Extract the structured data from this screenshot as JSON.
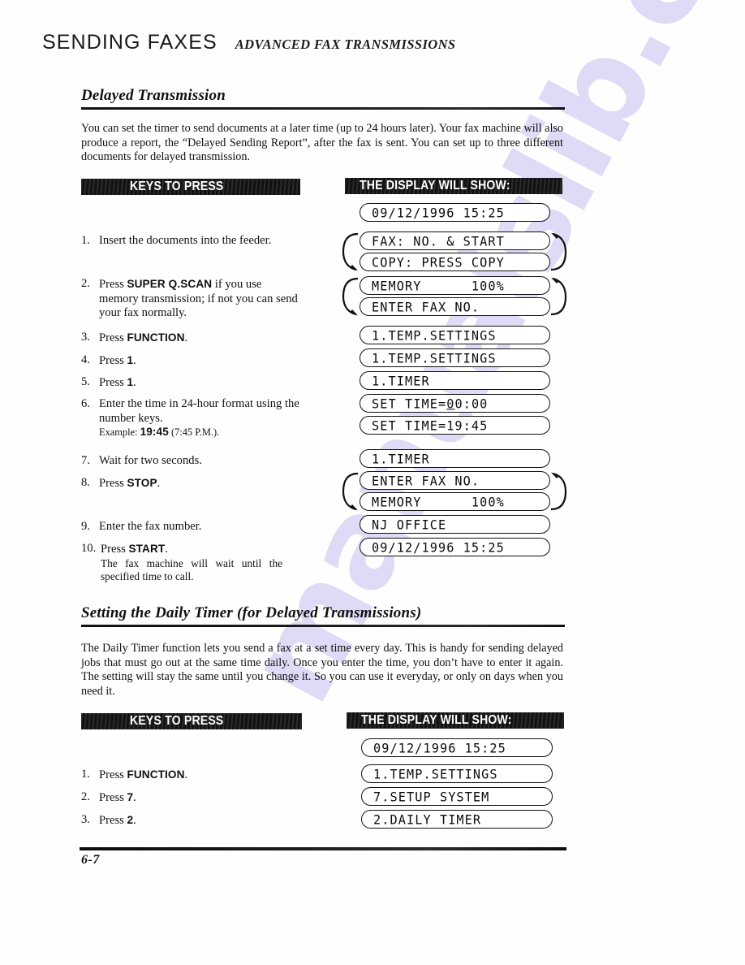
{
  "page": {
    "running_head_main": "SENDING FAXES",
    "running_head_sub": "ADVANCED FAX TRANSMISSIONS",
    "page_number": "6-7",
    "watermark": "manualslib.com"
  },
  "section1": {
    "title": "Delayed Transmission",
    "intro": "You can set the timer to send documents at a later time (up to 24 hours later). Your fax machine will also produce a report, the “Delayed Sending Report”, after the fax is sent. You can set up to three different documents for delayed transmission.",
    "keys_banner": "KEYS TO PRESS",
    "display_banner": "THE DISPLAY WILL SHOW:",
    "steps": [
      {
        "num": "1.",
        "text": "Insert the documents into the feeder."
      },
      {
        "num": "2.",
        "pre": "Press ",
        "key": "SUPER Q.SCAN",
        "post": " if you use memory transmission; if not you can send your fax normally."
      },
      {
        "num": "3.",
        "pre": "Press ",
        "key": "FUNCTION",
        "post": "."
      },
      {
        "num": "4.",
        "pre": "Press ",
        "key": "1",
        "post": "."
      },
      {
        "num": "5.",
        "pre": "Press ",
        "key": "1",
        "post": "."
      },
      {
        "num": "6.",
        "text": "Enter the time in 24-hour format using the number keys.",
        "sub_pre": "Example: ",
        "sub_key": "19:45",
        "sub_post": " (7:45 P.M.)."
      },
      {
        "num": "7.",
        "text": "Wait for two seconds."
      },
      {
        "num": "8.",
        "pre": "Press ",
        "key": "STOP",
        "post": "."
      },
      {
        "num": "9.",
        "text": "Enter the fax number."
      },
      {
        "num": "10.",
        "pre": "Press ",
        "key": "START",
        "post": ".",
        "note": "The fax machine will wait until the specified time to call."
      }
    ],
    "displays": [
      {
        "text": "09/12/1996 15:25"
      },
      {
        "text": "FAX: NO. & START"
      },
      {
        "text": "COPY: PRESS COPY"
      },
      {
        "text": "MEMORY      100%"
      },
      {
        "text": "ENTER FAX NO."
      },
      {
        "text": "1.TEMP.SETTINGS"
      },
      {
        "text": "1.TEMP.SETTINGS"
      },
      {
        "text": "1.TIMER"
      },
      {
        "pre": "SET TIME=",
        "cursor": "0",
        "post": "0:00"
      },
      {
        "text": "SET TIME=19:45"
      },
      {
        "text": "1.TIMER"
      },
      {
        "text": "ENTER FAX NO."
      },
      {
        "text": "MEMORY      100%"
      },
      {
        "text": "NJ OFFICE"
      },
      {
        "text": "09/12/1996 15:25"
      }
    ]
  },
  "section2": {
    "title": "Setting the Daily Timer (for Delayed Transmissions)",
    "intro": "The Daily Timer function lets you send a fax at a set time every day.  This is handy for sending delayed jobs that must go out at the same time daily.  Once you enter the time, you don’t have to enter it again.  The setting will stay the same until you change it.  So you can use it everyday, or only on days when you need it.",
    "keys_banner": "KEYS TO PRESS",
    "display_banner": "THE DISPLAY WILL SHOW:",
    "steps": [
      {
        "num": "1.",
        "pre": "Press ",
        "key": "FUNCTION",
        "post": "."
      },
      {
        "num": "2.",
        "pre": "Press ",
        "key": "7",
        "post": "."
      },
      {
        "num": "3.",
        "pre": "Press ",
        "key": "2",
        "post": "."
      }
    ],
    "displays": [
      {
        "text": "09/12/1996 15:25"
      },
      {
        "text": "1.TEMP.SETTINGS"
      },
      {
        "text": "7.SETUP SYSTEM"
      },
      {
        "text": "2.DAILY TIMER"
      }
    ]
  }
}
